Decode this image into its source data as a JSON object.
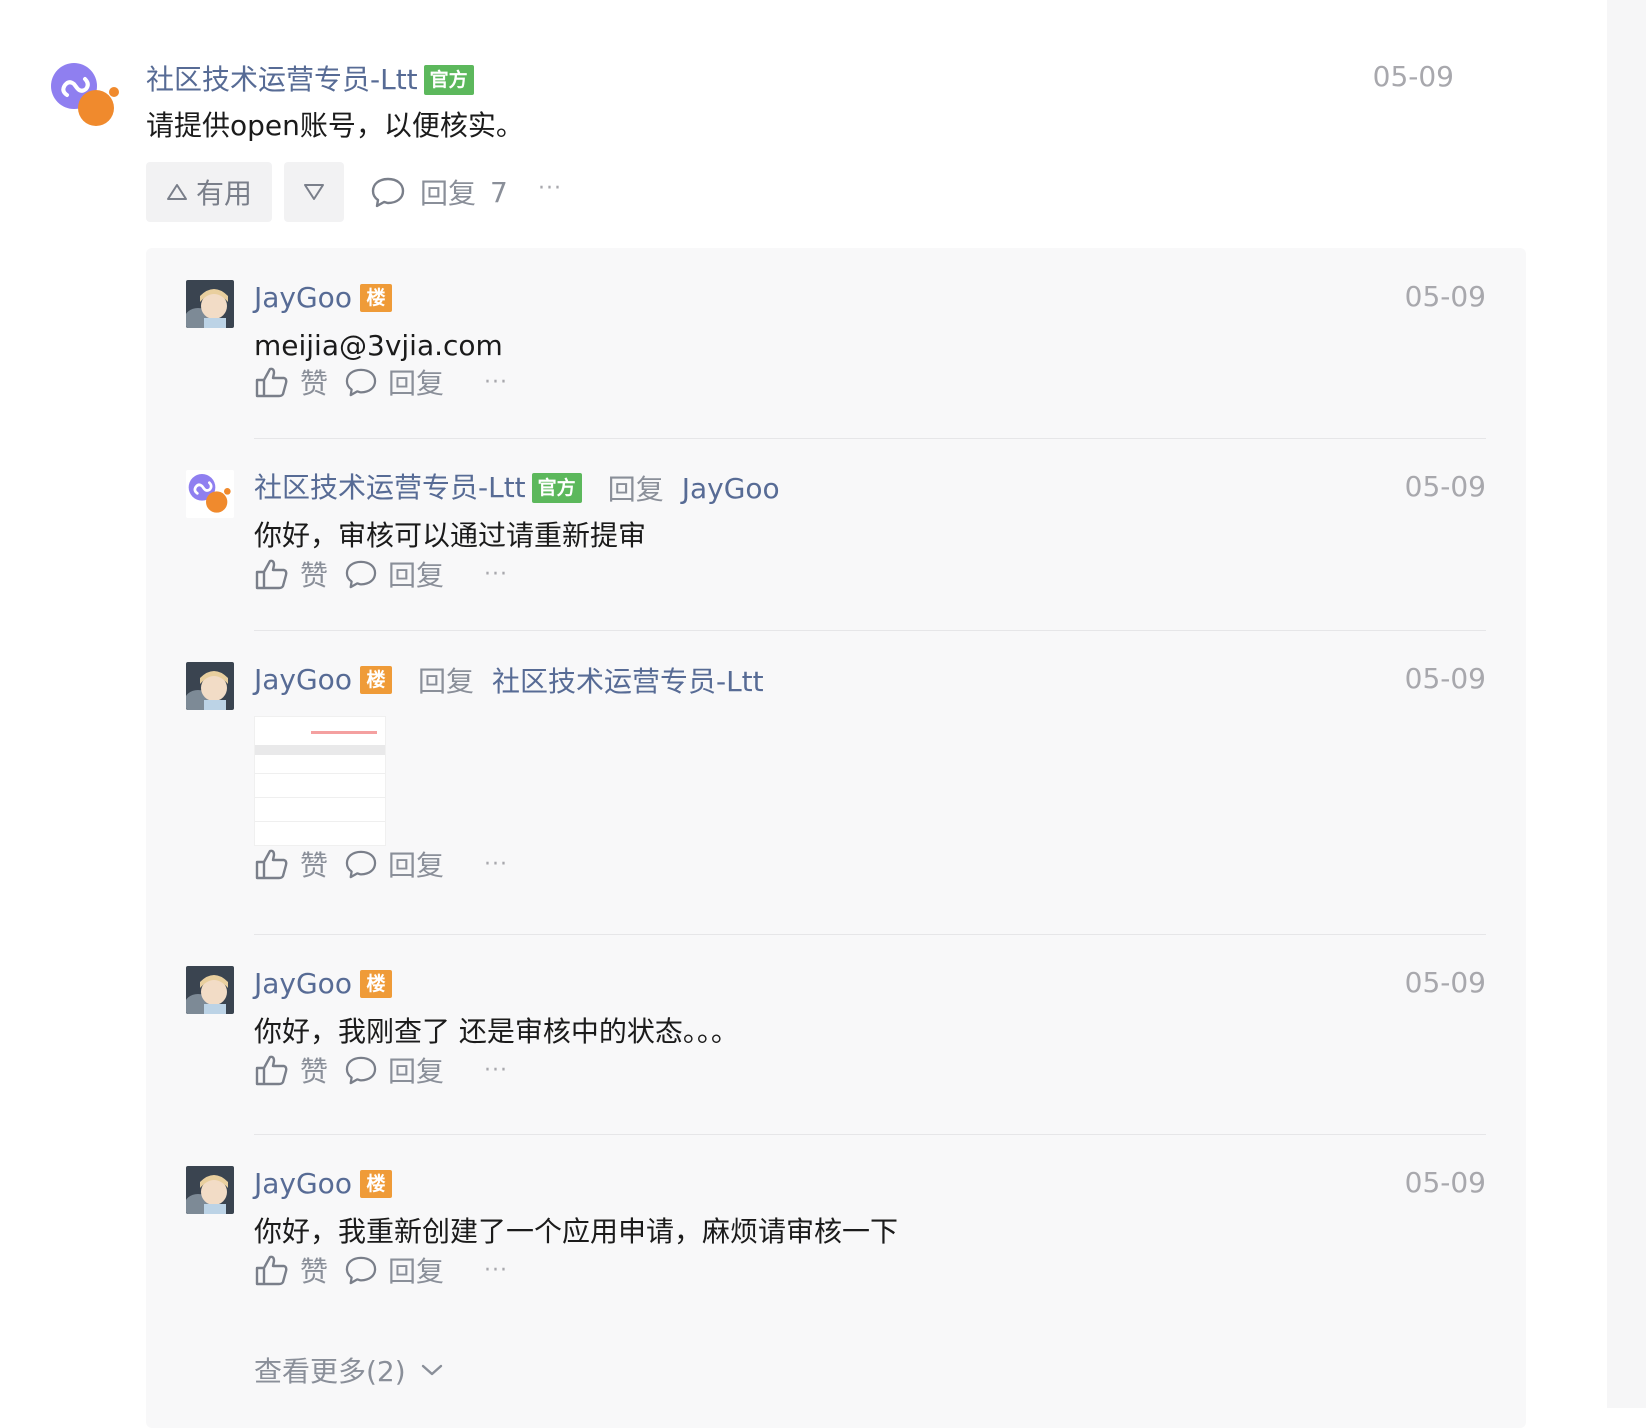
{
  "main_comment": {
    "author": "社区技术运营专员-Ltt",
    "badge": "官方",
    "date": "05-09",
    "text": "请提供open账号，以便核实。",
    "useful_label": "有用",
    "reply_label": "回复",
    "reply_count": "7",
    "more": "···"
  },
  "replies": [
    {
      "author": "JayGoo",
      "badge": "楼",
      "date": "05-09",
      "text": "meijia@3vjia.com",
      "like_label": "赞",
      "reply_label": "回复",
      "more": "···"
    },
    {
      "author": "社区技术运营专员-Ltt",
      "badge": "官方",
      "reply_word": "回复",
      "reply_to": "JayGoo",
      "date": "05-09",
      "text": "你好，审核可以通过请重新提审",
      "like_label": "赞",
      "reply_label": "回复",
      "more": "···"
    },
    {
      "author": "JayGoo",
      "badge": "楼",
      "reply_word": "回复",
      "reply_to": "社区技术运营专员-Ltt",
      "date": "05-09",
      "like_label": "赞",
      "reply_label": "回复",
      "more": "···"
    },
    {
      "author": "JayGoo",
      "badge": "楼",
      "date": "05-09",
      "text": "你好，我刚查了 还是审核中的状态。。。",
      "like_label": "赞",
      "reply_label": "回复",
      "more": "···"
    },
    {
      "author": "JayGoo",
      "badge": "楼",
      "date": "05-09",
      "text": "你好，我重新创建了一个应用申请，麻烦请审核一下",
      "like_label": "赞",
      "reply_label": "回复",
      "more": "···"
    }
  ],
  "see_more": "查看更多(2)",
  "colors": {
    "name": "#576b95",
    "official_badge": "#5cb85c",
    "floor_badge": "#ef9b38",
    "panel_bg": "#f8f8f9"
  },
  "icons": [
    "official-avatar",
    "user-avatar",
    "thumbs-up-icon",
    "comment-icon",
    "triangle-up-icon",
    "triangle-down-icon",
    "chevron-down-icon",
    "more-icon"
  ]
}
